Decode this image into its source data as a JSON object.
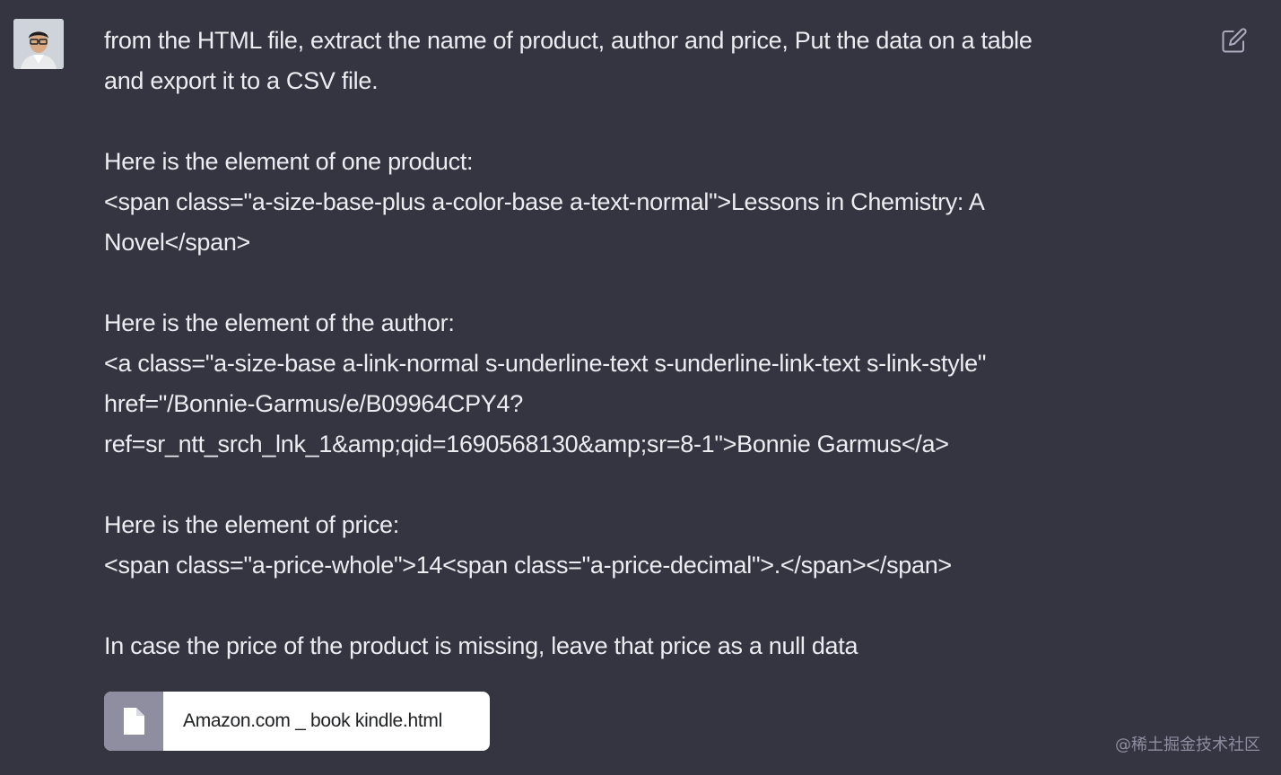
{
  "message": {
    "lines": [
      "from the HTML file, extract the name of product, author and price, Put the data on a table",
      "and export it to a CSV file.",
      "",
      "Here is the element of one product:",
      "<span class=\"a-size-base-plus a-color-base a-text-normal\">Lessons in Chemistry: A",
      "Novel</span>",
      "",
      "Here is the element of the author:",
      "<a class=\"a-size-base a-link-normal s-underline-text s-underline-link-text s-link-style\"",
      "href=\"/Bonnie-Garmus/e/B09964CPY4?",
      "ref=sr_ntt_srch_lnk_1&amp;qid=1690568130&amp;sr=8-1\">Bonnie Garmus</a>",
      "",
      "Here is the element of price:",
      "<span class=\"a-price-whole\">14<span class=\"a-price-decimal\">.</span></span>",
      "",
      "In case the price of the product is missing, leave that price as a null data"
    ]
  },
  "attachment": {
    "file_name": "Amazon.com _ book kindle.html",
    "icon": "file-icon"
  },
  "user": {
    "avatar_icon": "avatar"
  },
  "edit": {
    "icon": "edit-icon"
  },
  "watermark": "@稀土掘金技术社区",
  "colors": {
    "background": "#343541",
    "text": "#ececf1",
    "attachment_bg": "#ffffff",
    "attachment_icon_bg": "#8e8ea0"
  }
}
